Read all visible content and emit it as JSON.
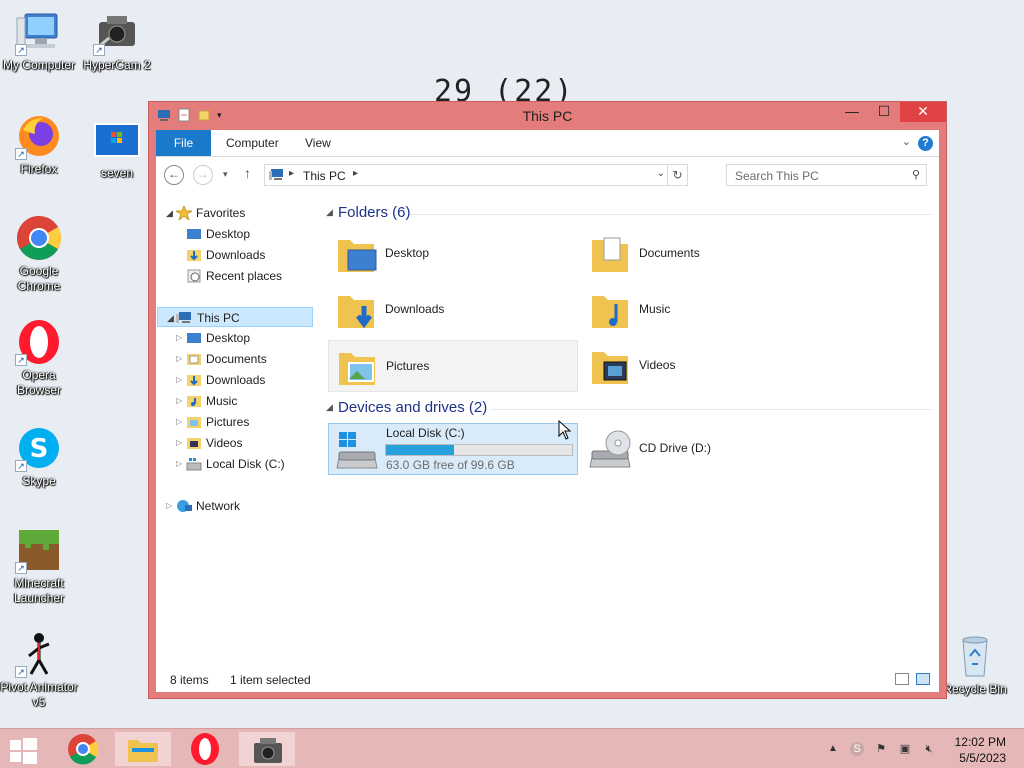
{
  "desktop": {
    "bg_text": "29 (22)",
    "icons": [
      {
        "label": "My Computer"
      },
      {
        "label": "HyperCam 2"
      },
      {
        "label": "Firefox"
      },
      {
        "label": "seven"
      },
      {
        "label": "Google Chrome"
      },
      {
        "label": "Opera Browser"
      },
      {
        "label": "Skype"
      },
      {
        "label": "Minecraft Launcher"
      },
      {
        "label": "Pivot Animator v5"
      },
      {
        "label": "Recycle Bin"
      }
    ]
  },
  "window": {
    "title": "This PC",
    "tabs": {
      "file": "File",
      "computer": "Computer",
      "view": "View"
    },
    "help": "?",
    "address": {
      "path": "This PC"
    },
    "search": {
      "placeholder": "Search This PC"
    },
    "nav": {
      "favorites": "Favorites",
      "fav_items": [
        "Desktop",
        "Downloads",
        "Recent places"
      ],
      "this_pc": "This PC",
      "pc_items": [
        "Desktop",
        "Documents",
        "Downloads",
        "Music",
        "Pictures",
        "Videos",
        "Local Disk (C:)"
      ],
      "network": "Network"
    },
    "folders_header": "Folders (6)",
    "folders": [
      "Desktop",
      "Documents",
      "Downloads",
      "Music",
      "Pictures",
      "Videos"
    ],
    "drives_header": "Devices and drives (2)",
    "drives": [
      {
        "name": "Local Disk (C:)",
        "free": "63.0 GB free of 99.6 GB",
        "used_fraction": 0.367
      },
      {
        "name": "CD Drive (D:)"
      }
    ],
    "status": {
      "items": "8 items",
      "selected": "1 item selected"
    }
  },
  "taskbar": {
    "time": "12:02 PM",
    "date": "5/5/2023"
  },
  "colors": {
    "accent": "#1979ca",
    "window_frame": "#e47c7c",
    "taskbar": "#e5b7b7",
    "group_header": "#1e3287"
  }
}
